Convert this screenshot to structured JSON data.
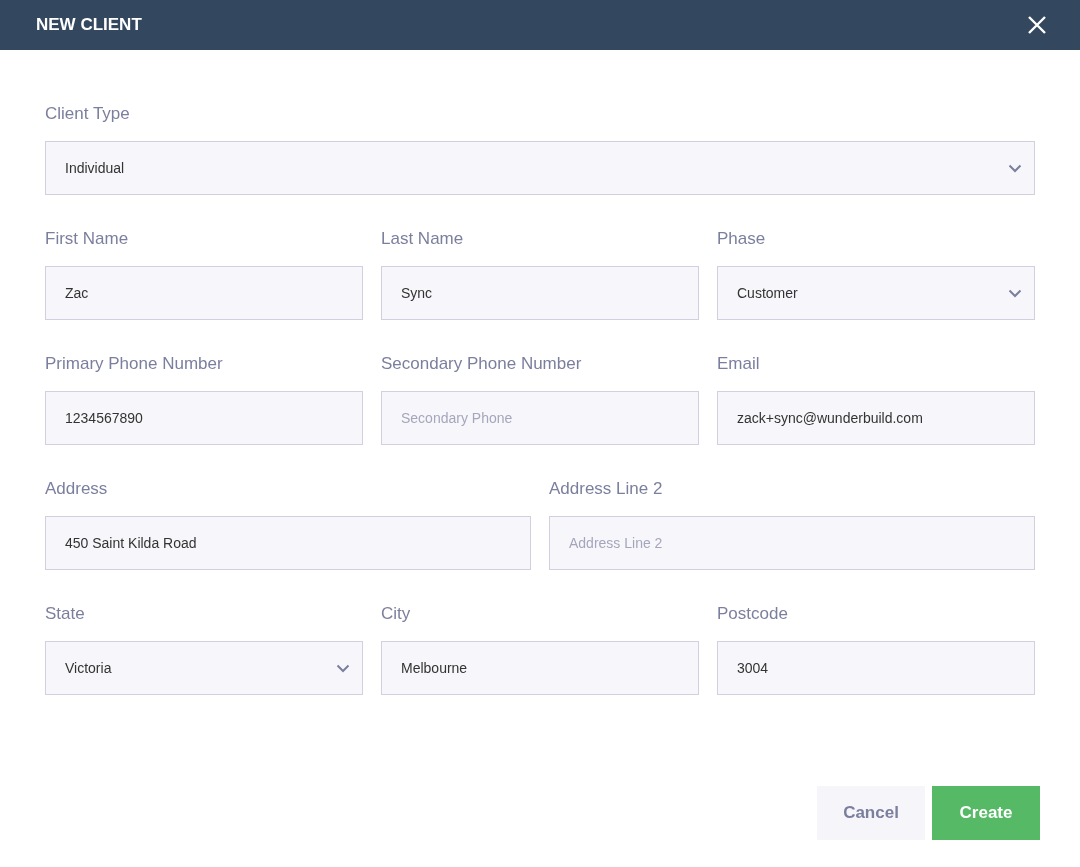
{
  "dialog": {
    "title": "NEW CLIENT"
  },
  "rows": [
    [
      {
        "kind": "select",
        "label": "Client Type",
        "value": "Individual"
      }
    ],
    [
      {
        "kind": "input",
        "label": "First Name",
        "value": "Zac"
      },
      {
        "kind": "input",
        "label": "Last Name",
        "value": "Sync"
      },
      {
        "kind": "select",
        "label": "Phase",
        "value": "Customer"
      }
    ],
    [
      {
        "kind": "input",
        "label": "Primary Phone Number",
        "value": "1234567890"
      },
      {
        "kind": "input",
        "label": "Secondary Phone Number",
        "placeholder": "Secondary Phone"
      },
      {
        "kind": "input",
        "label": "Email",
        "value": "zack+sync@wunderbuild.com"
      }
    ],
    [
      {
        "kind": "input",
        "label": "Address",
        "value": "450 Saint Kilda Road"
      },
      {
        "kind": "input",
        "label": "Address Line 2",
        "placeholder": "Address Line 2"
      }
    ],
    [
      {
        "kind": "select",
        "label": "State",
        "value": "Victoria"
      },
      {
        "kind": "input",
        "label": "City",
        "value": "Melbourne"
      },
      {
        "kind": "input",
        "label": "Postcode",
        "value": "3004"
      }
    ]
  ],
  "buttons": [
    {
      "kind": "secondary",
      "label": "Cancel"
    },
    {
      "kind": "primary",
      "label": "Create"
    }
  ]
}
